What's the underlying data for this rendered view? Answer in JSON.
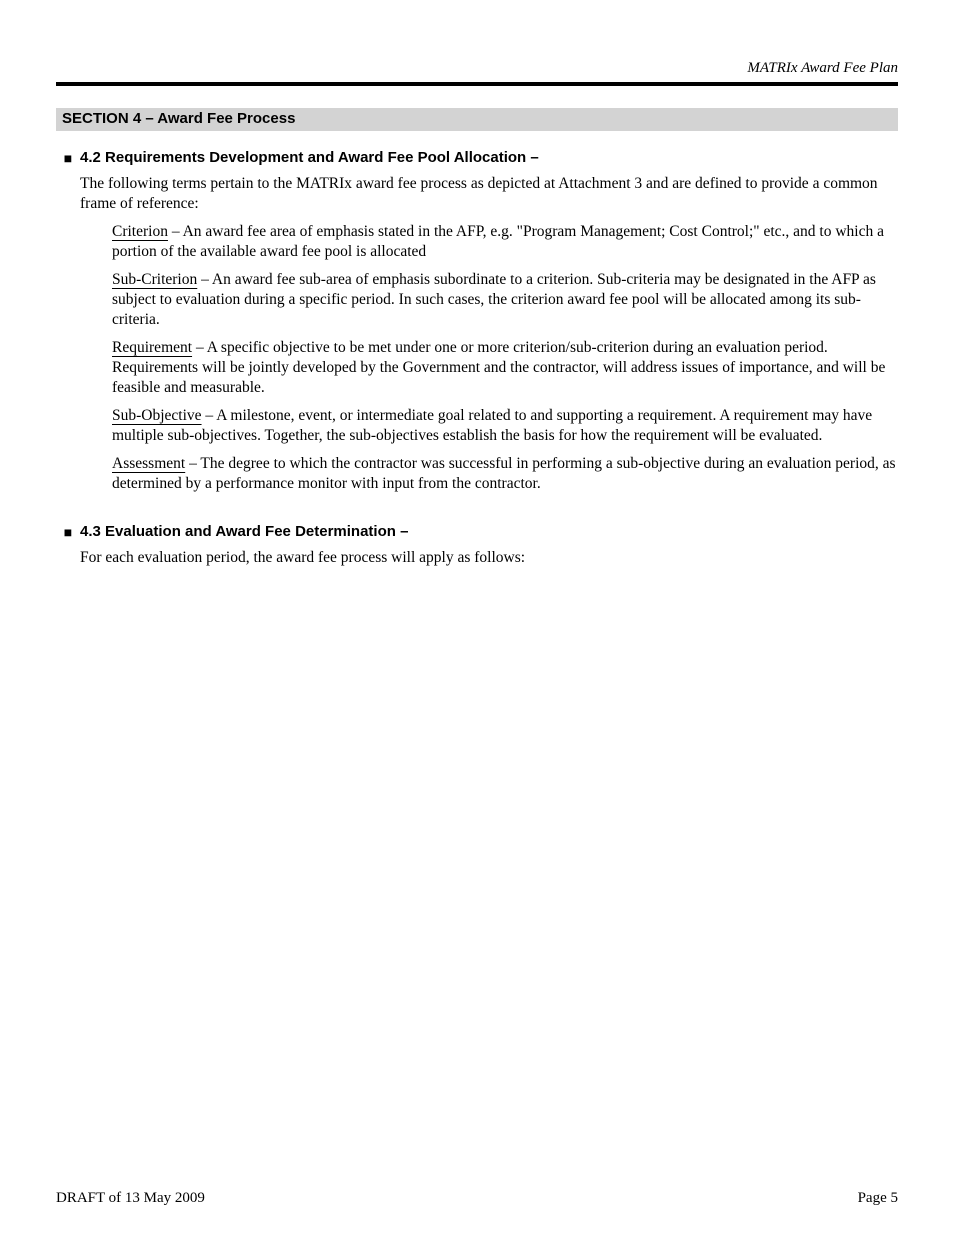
{
  "running_head": "MATRIx Award Fee Plan",
  "section_heading": "SECTION 4 – Award Fee Process",
  "items": [
    {
      "label": "4.2 Requirements Development and Award Fee Pool Allocation –",
      "body": "The following terms pertain to the MATRIx award fee process as depicted at Attachment 3 and are defined to provide a common frame of reference:",
      "subs": [
        {
          "u": "Criterion",
          "rest": " – An award fee area of emphasis stated in the AFP, e.g. \"Program Management; Cost Control;\" etc., and to which a portion of the available award fee pool is allocated"
        },
        {
          "u": "Sub-Criterion",
          "rest": " – An award fee sub-area of emphasis subordinate to a criterion. Sub-criteria may be designated in the AFP as subject to evaluation during a specific period. In such cases, the criterion award fee pool will be allocated among its sub-criteria."
        },
        {
          "u": "Requirement",
          "rest": " – A specific objective to be met under one or more criterion/sub-criterion during an evaluation period. Requirements will be jointly developed by the Government and the contractor, will address issues of importance, and will be feasible and measurable."
        },
        {
          "u": "Sub-Objective",
          "rest": " – A milestone, event, or intermediate goal related to and supporting a requirement. A requirement may have multiple sub-objectives. Together, the sub-objectives establish the basis for how the requirement will be evaluated."
        },
        {
          "u": "Assessment",
          "rest": " – The degree to which the contractor was successful in performing a sub-objective during an evaluation period, as determined by a performance monitor with input from the contractor."
        }
      ]
    },
    {
      "label": "4.3 Evaluation and Award Fee Determination –",
      "body": "For each evaluation period, the award fee process will apply as follows:"
    }
  ],
  "footer": {
    "left": "DRAFT of 13 May 2009",
    "right": "Page 5"
  }
}
